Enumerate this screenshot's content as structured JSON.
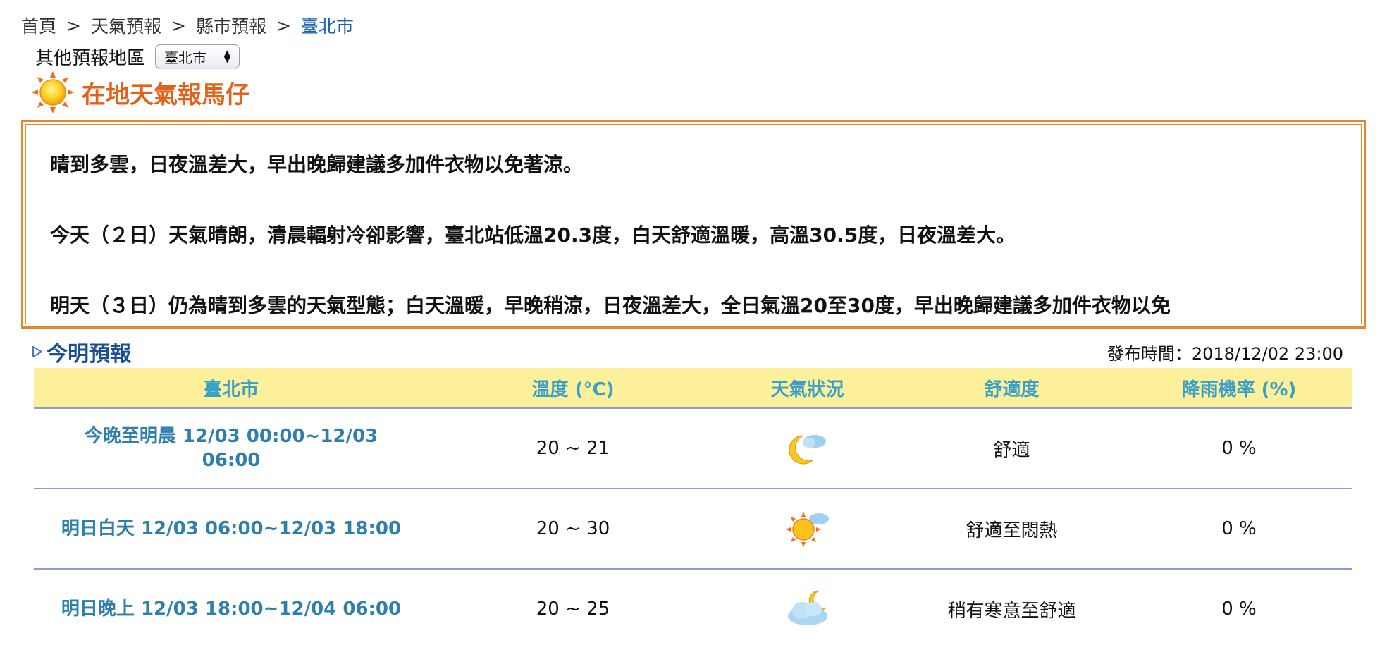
{
  "breadcrumb": {
    "items": [
      "首頁",
      "天氣預報",
      "縣市預報"
    ],
    "current": "臺北市",
    "separator": ">"
  },
  "region": {
    "label": "其他預報地區",
    "selected": "臺北市"
  },
  "local": {
    "title": "在地天氣報馬仔",
    "paragraphs": [
      "晴到多雲，日夜溫差大，早出晚歸建議多加件衣物以免著涼。",
      "今天（２日）天氣晴朗，清晨輻射冷卻影響，臺北站低溫20.3度，白天舒適溫暖，高溫30.5度，日夜溫差大。",
      "明天（３日）仍為晴到多雲的天氣型態；白天溫暖，早晚稍涼，日夜溫差大，全日氣溫20至30度，早出晚歸建議多加件衣物以免"
    ]
  },
  "forecast": {
    "section_title": "今明預報",
    "publish_time": "發布時間：2018/12/02 23:00",
    "headers": [
      "臺北市",
      "溫度 (°C)",
      "天氣狀況",
      "舒適度",
      "降雨機率 (%)"
    ],
    "rows": [
      {
        "period": "今晚至明晨 12/03 00:00~12/03 06:00",
        "temp": "20 ~ 21",
        "icon": "moon-cloud-icon",
        "comfort": "舒適",
        "rain": "0 %"
      },
      {
        "period": "明日白天 12/03 06:00~12/03 18:00",
        "temp": "20 ~ 30",
        "icon": "sun-cloud-icon",
        "comfort": "舒適至悶熱",
        "rain": "0 %"
      },
      {
        "period": "明日晚上 12/03 18:00~12/04 06:00",
        "temp": "20 ~ 25",
        "icon": "cloud-moon-icon",
        "comfort": "稍有寒意至舒適",
        "rain": "0 %"
      }
    ]
  },
  "colors": {
    "link": "#1a63b0",
    "title_orange": "#e2621b",
    "box_border": "#e08a2d",
    "header_bg": "#fcf09b",
    "header_text": "#3aa0c8",
    "period_text": "#2e7fab",
    "section_title": "#1a4e96",
    "row_divider": "#8f9bd3"
  }
}
